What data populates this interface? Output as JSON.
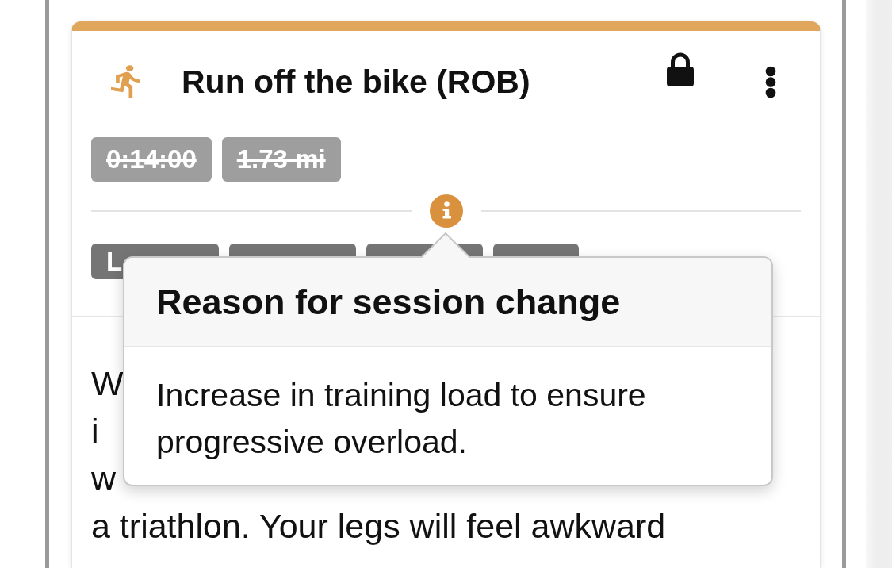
{
  "session": {
    "kind": "run",
    "title": "Run off the bike (ROB)",
    "locked": true,
    "original_targets": [
      {
        "text": "0:14:00",
        "struck": true
      },
      {
        "text": "1.73 mi",
        "struck": true
      }
    ],
    "updated_targets": [
      {
        "kind": "label",
        "text": "L"
      },
      {
        "kind": "covered"
      },
      {
        "kind": "covered"
      },
      {
        "kind": "covered"
      }
    ],
    "description_lines": [
      "W",
      "i",
      "w",
      "a triathlon. Your legs will feel awkward"
    ]
  },
  "popover": {
    "title": "Reason for session change",
    "text": "Increase in training load to ensure progressive overload."
  }
}
